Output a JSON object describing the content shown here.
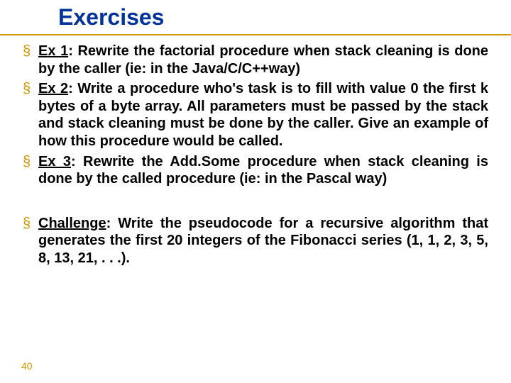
{
  "title": "Exercises",
  "items": [
    {
      "label": "Ex 1",
      "text": ": Rewrite the factorial procedure when stack cleaning is done by the caller (ie: in the Java/C/C++way)"
    },
    {
      "label": "Ex 2",
      "text": ": Write a procedure who's task is to fill with value 0 the first k bytes of a byte array. All parameters must be passed by the stack and stack cleaning must be done by the caller. Give an example of how this procedure would be called."
    },
    {
      "label": "Ex 3",
      "text": ": Rewrite the Add.Some procedure when stack cleaning is done by the called procedure (ie: in the Pascal way)"
    }
  ],
  "challenge": {
    "label": "Challenge",
    "text": ": Write the pseudocode for a recursive algorithm that generates the first 20 integers of the Fibonacci series (1, 1, 2, 3, 5, 8, 13, 21, . . .)."
  },
  "page_number": "40"
}
